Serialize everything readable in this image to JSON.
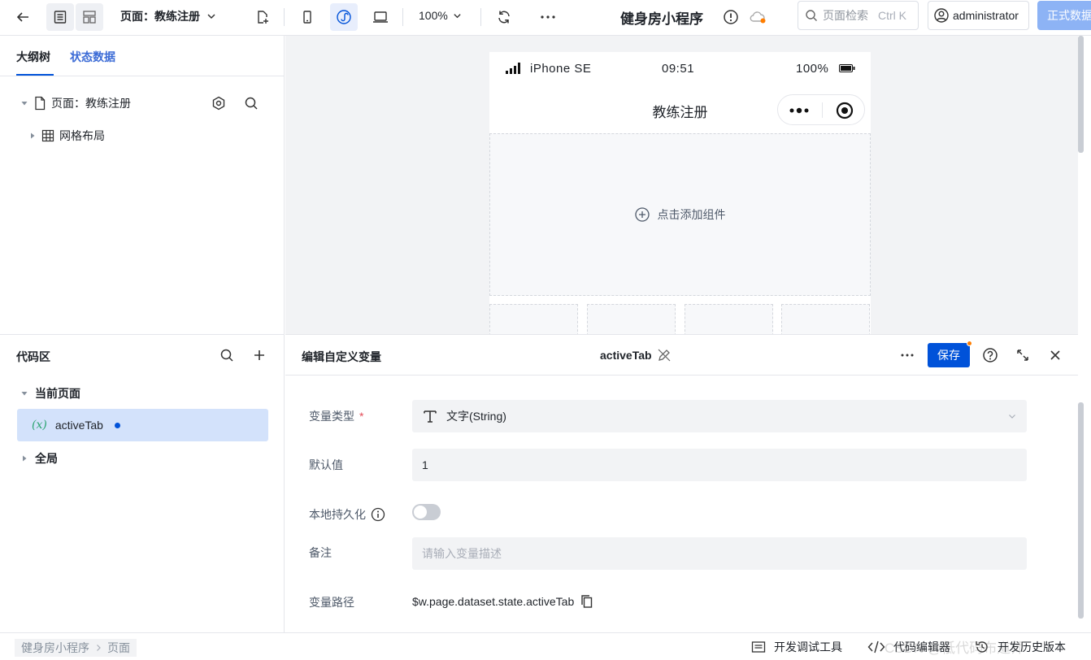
{
  "topbar": {
    "page_select_label": "页面：教练注册",
    "zoom_level": "100%",
    "app_title": "健身房小程序",
    "search_placeholder": "页面检索",
    "search_shortcut": "Ctrl K",
    "username": "administrator",
    "publish_label": "正式数据"
  },
  "outline": {
    "tabs": [
      "大纲树",
      "状态数据"
    ],
    "tree": [
      {
        "label": "页面：教练注册",
        "icon": "page-icon"
      },
      {
        "label": "网格布局",
        "icon": "grid-icon"
      }
    ]
  },
  "phone": {
    "device": "iPhone SE",
    "time": "09:51",
    "battery": "100%",
    "nav_title": "教练注册",
    "add_component_label": "点击添加组件"
  },
  "code_area": {
    "title": "代码区",
    "groups": [
      {
        "label": "当前页面",
        "expanded": true
      },
      {
        "label": "全局",
        "expanded": false
      }
    ],
    "variables": [
      {
        "name": "activeTab",
        "fx": "(𝑥)",
        "modified": true
      }
    ]
  },
  "editor": {
    "title": "编辑自定义变量",
    "var_name": "activeTab",
    "save_label": "保存",
    "fields": {
      "type_label": "变量类型",
      "type_value": "文字(String)",
      "default_label": "默认值",
      "default_value": "1",
      "persist_label": "本地持久化",
      "persist_on": false,
      "note_label": "备注",
      "note_placeholder": "请输入变量描述",
      "path_label": "变量路径",
      "path_value": "$w.page.dataset.state.activeTab"
    }
  },
  "bottombar": {
    "breadcrumb": [
      "健身房小程序",
      "页面"
    ],
    "debug_tools": "开发调试工具",
    "code_editor": "代码编辑器",
    "history": "开发历史版本",
    "watermark": "CSDN @低代码布道师"
  },
  "colors": {
    "primary": "#0052d9",
    "publish_disabled": "#8db3f5",
    "selected_bg": "#d3e2fb",
    "badge_orange": "#ff7d00",
    "fx_green": "#2ba471"
  }
}
